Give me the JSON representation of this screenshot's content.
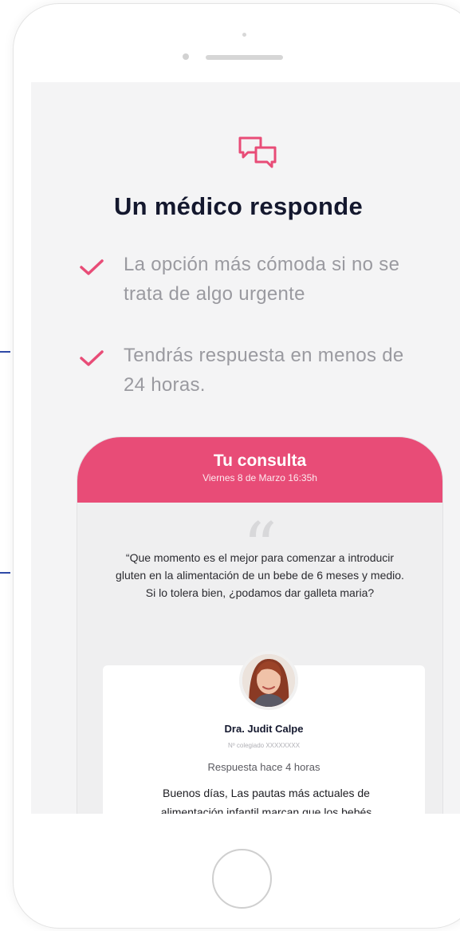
{
  "app": {
    "heading": "Un médico responde",
    "benefits": [
      "La opción más cómoda si no se trata de algo urgente",
      "Tendrás respuesta en menos de 24 horas."
    ]
  },
  "consultation": {
    "title": "Tu consulta",
    "date": "Viernes 8 de Marzo 16:35h",
    "question": "“Que momento es el mejor para comenzar a introducir gluten en la alimentación de un bebe de 6 meses y medio. Si lo tolera bien, ¿podamos dar galleta maria?",
    "answer": {
      "doctor_name": "Dra. Judit Calpe",
      "license": "Nº colegiado XXXXXXXX",
      "time": "Respuesta hace 4 horas",
      "text": "Buenos días, Las pautas más actuales de alimentación infantil marcan que los bebés"
    }
  },
  "icons": {
    "header": "chat-bubbles-icon",
    "benefit": "check-icon",
    "quote": "quote-icon",
    "avatar": "doctor-avatar"
  },
  "colors": {
    "accent": "#e84c77",
    "heading": "#14182e",
    "muted_text": "#9a9aa0",
    "screen_bg": "#f4f4f5"
  }
}
